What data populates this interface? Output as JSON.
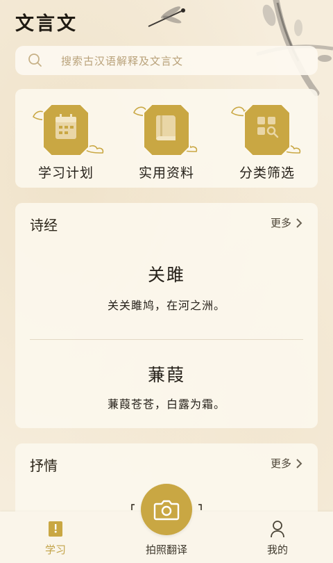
{
  "header": {
    "title": "文言文"
  },
  "search": {
    "placeholder": "搜索古汉语解释及文言文"
  },
  "shortcuts": [
    {
      "label": "学习计划",
      "icon": "calendar-icon"
    },
    {
      "label": "实用资料",
      "icon": "book-icon"
    },
    {
      "label": "分类筛选",
      "icon": "category-search-icon"
    }
  ],
  "section_shijing": {
    "title": "诗经",
    "more": "更多",
    "poems": [
      {
        "title": "关雎",
        "line": "关关雎鸠，在河之洲。"
      },
      {
        "title": "蒹葭",
        "line": "蒹葭苍苍，白露为霜。"
      }
    ]
  },
  "section_shuqing": {
    "title": "抒情",
    "more": "更多"
  },
  "nav": {
    "items": [
      {
        "label": "学习",
        "icon": "study-icon",
        "active": true
      },
      {
        "label": "拍照翻译",
        "icon": "camera-icon",
        "active": false
      },
      {
        "label": "我的",
        "icon": "user-icon",
        "active": false
      }
    ]
  },
  "colors": {
    "accent": "#c9a743",
    "accent_text": "#c2a348",
    "background": "#f5ecda"
  }
}
